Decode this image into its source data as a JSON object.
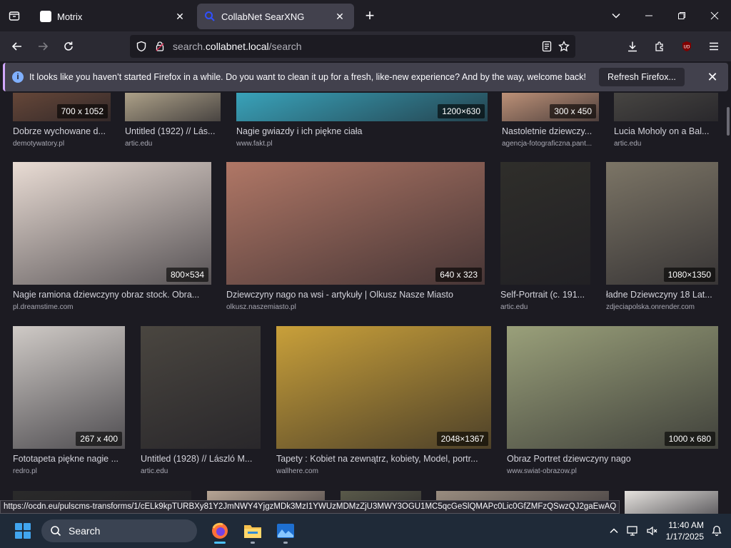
{
  "tabs": [
    {
      "title": "Motrix",
      "active": false
    },
    {
      "title": "CollabNet SearXNG",
      "active": true
    }
  ],
  "navbar": {
    "url_prefix": "search.",
    "url_domain": "collabnet.local",
    "url_path": "/search"
  },
  "notification": {
    "message": "It looks like you haven’t started Firefox in a while. Do you want to clean it up for a fresh, like-new experience? And by the way, welcome back!",
    "button_label": "Refresh Firefox..."
  },
  "results": [
    {
      "title": "Dobrze wychowane d...",
      "source": "demotywatory.pl",
      "resolution": "700 x 1052",
      "color": "#6b4a3a"
    },
    {
      "title": "Untitled (1922) // Lás...",
      "source": "artic.edu",
      "resolution": "",
      "color": "#b8ab90"
    },
    {
      "title": "Nagie gwiazdy i ich piękne ciała",
      "source": "www.fakt.pl",
      "resolution": "1200×630",
      "color": "#3aa8c0"
    },
    {
      "title": "Nastoletnie dziewczy...",
      "source": "agencja-fotograficzna.pant...",
      "resolution": "300 x 450",
      "color": "#c99a7e"
    },
    {
      "title": "Lucia Moholy on a Bal...",
      "source": "artic.edu",
      "resolution": "",
      "color": "#4a4844"
    },
    {
      "title": "Nagie ramiona dziewczyny obraz stock. Obra...",
      "source": "pl.dreamstime.com",
      "resolution": "800×534",
      "color": "#e9dcd4"
    },
    {
      "title": "Dziewczyny nago na wsi - artykuły | Olkusz Nasze Miasto",
      "source": "olkusz.naszemiasto.pl",
      "resolution": "640 x 323",
      "color": "#b07766"
    },
    {
      "title": "Self-Portrait (c. 191...",
      "source": "artic.edu",
      "resolution": "",
      "color": "#2f2e2a"
    },
    {
      "title": "ładne Dziewczyny 18 Lat...",
      "source": "zdjeciapolska.onrender.com",
      "resolution": "1080×1350",
      "color": "#7c7566"
    },
    {
      "title": "Fototapeta piękne nagie ...",
      "source": "redro.pl",
      "resolution": "267 x 400",
      "color": "#cfcac6"
    },
    {
      "title": "Untitled (1928) // László M...",
      "source": "artic.edu",
      "resolution": "",
      "color": "#4a4640"
    },
    {
      "title": "Tapety : Kobiet na zewnątrz, kobiety, Model, portr...",
      "source": "wallhere.com",
      "resolution": "2048×1367",
      "color": "#c9a03a"
    },
    {
      "title": "Obraz Portret dziewczyny nago",
      "source": "www.swiat-obrazow.pl",
      "resolution": "1000 x 680",
      "color": "#9aa07a"
    },
    {
      "title": "",
      "source": "",
      "resolution": "",
      "color": "#2a2a2a"
    },
    {
      "title": "",
      "source": "",
      "resolution": "",
      "color": "#b7a595"
    },
    {
      "title": "",
      "source": "",
      "resolution": "",
      "color": "#5a5a4a"
    },
    {
      "title": "",
      "source": "",
      "resolution": "",
      "color": "#9a8d80"
    },
    {
      "title": "",
      "source": "",
      "resolution": "",
      "color": "#e5e2de"
    }
  ],
  "status_url": "https://ocdn.eu/pulscms-transforms/1/cELk9kpTURBXy81Y2JmNWY4YjgzMDk3MzI1YWUzMDMzZjU3MWY3OGU1MC5qcGeSlQMAPc0Lic0GfZMFzQSwzQJ2gaEwAQ",
  "taskbar": {
    "search_label": "Search",
    "time": "11:40 AM",
    "date": "1/17/2025"
  }
}
